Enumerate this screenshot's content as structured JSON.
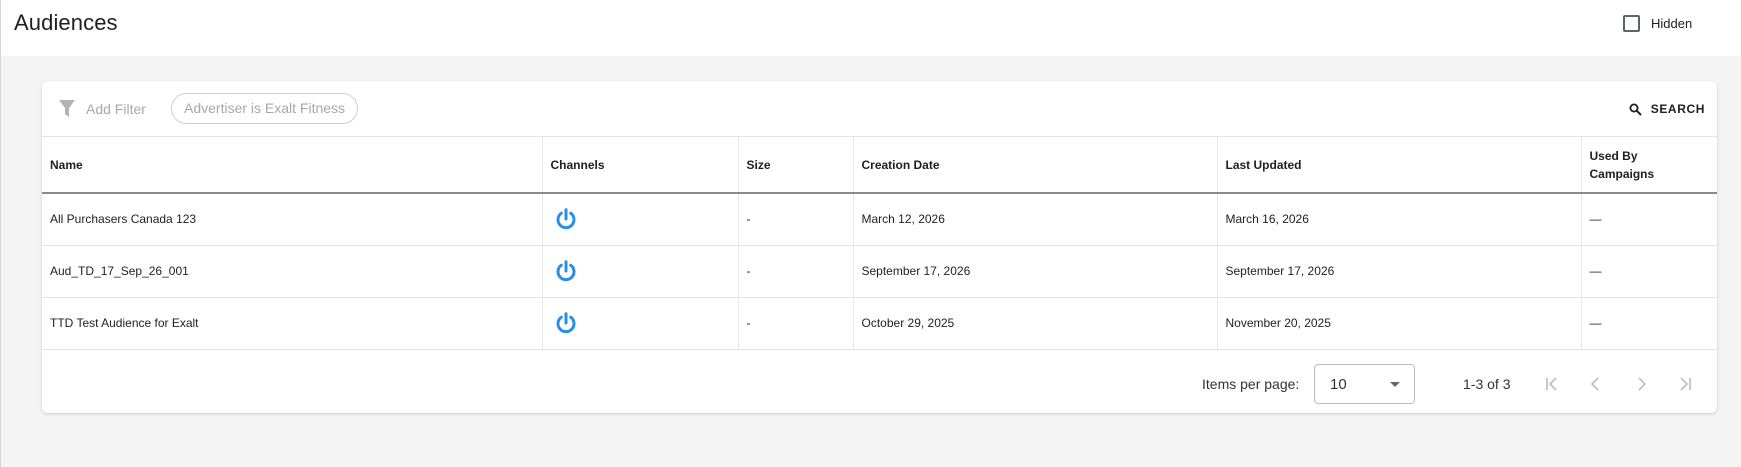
{
  "header": {
    "title": "Audiences",
    "hidden_label": "Hidden"
  },
  "filter": {
    "add_filter_label": "Add Filter",
    "chip_label": "Advertiser is Exalt Fitness",
    "search_label": "SEARCH"
  },
  "table": {
    "columns": [
      "Name",
      "Channels",
      "Size",
      "Creation Date",
      "Last Updated",
      "Used By\nCampaigns"
    ],
    "rows": [
      {
        "name": "All Purchasers Canada 123",
        "channel_icon": "power-icon",
        "size": "-",
        "created": "March 12, 2026",
        "updated": "March 16, 2026",
        "used_by": "—"
      },
      {
        "name": "Aud_TD_17_Sep_26_001",
        "channel_icon": "power-icon",
        "size": "-",
        "created": "September 17, 2026",
        "updated": "September 17, 2026",
        "used_by": "—"
      },
      {
        "name": "TTD Test Audience for Exalt",
        "channel_icon": "power-icon",
        "size": "-",
        "created": "October 29, 2025",
        "updated": "November 20, 2025",
        "used_by": "—"
      }
    ]
  },
  "paginator": {
    "items_per_page_label": "Items per page:",
    "items_per_page_value": "10",
    "range_label": "1-3 of 3"
  },
  "colors": {
    "channel_icon": "#2a8de9",
    "muted": "#a8a8a8",
    "background": "#f4f4f4"
  }
}
